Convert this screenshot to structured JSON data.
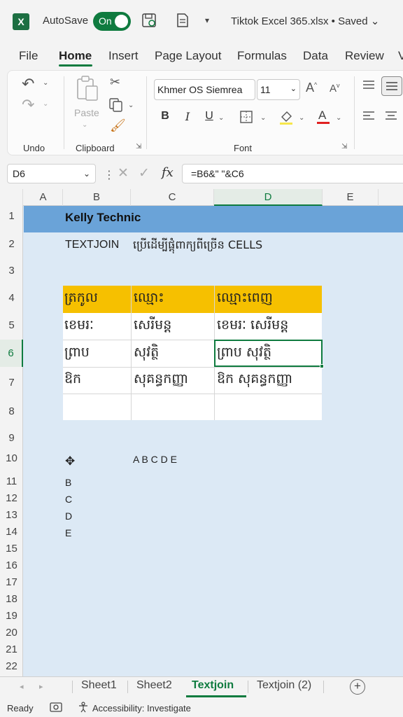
{
  "titlebar": {
    "app_icon": "X",
    "autosave_label": "AutoSave",
    "toggle_label": "On",
    "filename": "Tiktok Excel 365.xlsx • Saved ⌄"
  },
  "menu": {
    "tabs": [
      "File",
      "Home",
      "Insert",
      "Page Layout",
      "Formulas",
      "Data",
      "Review",
      "V"
    ],
    "active": "Home"
  },
  "ribbon": {
    "undo_label": "Undo",
    "clipboard_label": "Clipboard",
    "paste_label": "Paste",
    "font_label": "Font",
    "font_name": "Khmer OS Siemrea",
    "font_size": "11",
    "bold": "B",
    "italic": "I",
    "underline": "U"
  },
  "formula_bar": {
    "cell_ref": "D6",
    "fx": "fx",
    "formula": "=B6&\" \"&C6"
  },
  "columns": [
    "A",
    "B",
    "C",
    "D",
    "E"
  ],
  "rows": [
    "1",
    "2",
    "3",
    "4",
    "5",
    "6",
    "7",
    "8",
    "9",
    "10",
    "11",
    "12",
    "13",
    "14",
    "15",
    "16",
    "17",
    "18",
    "19",
    "20",
    "21",
    "22"
  ],
  "cells": {
    "b1": "Kelly Technic",
    "b2": "TEXTJOIN",
    "c2": "ប្រើដើម្បីផ្តុំពាក្យពីច្រើន CELLS",
    "table": {
      "headers": [
        "ត្រកូល",
        "ឈ្មោះ",
        "ឈ្មោះពេញ"
      ],
      "rows": [
        [
          "ខេមរៈ",
          "សេរីមន្ត",
          "ខេមរៈ សេរីមន្ត"
        ],
        [
          "ព្រាប",
          "សុវត្ថិ",
          "ព្រាប សុវត្ថិ"
        ],
        [
          "ឱក",
          "សុគន្ធកញ្ញា",
          "ឱក សុគន្ធកញ្ញា"
        ],
        [
          "",
          "",
          ""
        ]
      ]
    },
    "c10": "A B C D E",
    "b11": "B",
    "b12": "C",
    "b13": "D",
    "b14": "E"
  },
  "sheets": [
    "Sheet1",
    "Sheet2",
    "Textjoin",
    "Textjoin (2)"
  ],
  "active_sheet": "Textjoin",
  "status": {
    "ready": "Ready",
    "accessibility": "Accessibility: Investigate"
  },
  "colors": {
    "accent": "#0f7b3f",
    "header_band": "#6aa3d8",
    "table_header": "#f6c000",
    "grid_bg": "#dce9f5"
  }
}
